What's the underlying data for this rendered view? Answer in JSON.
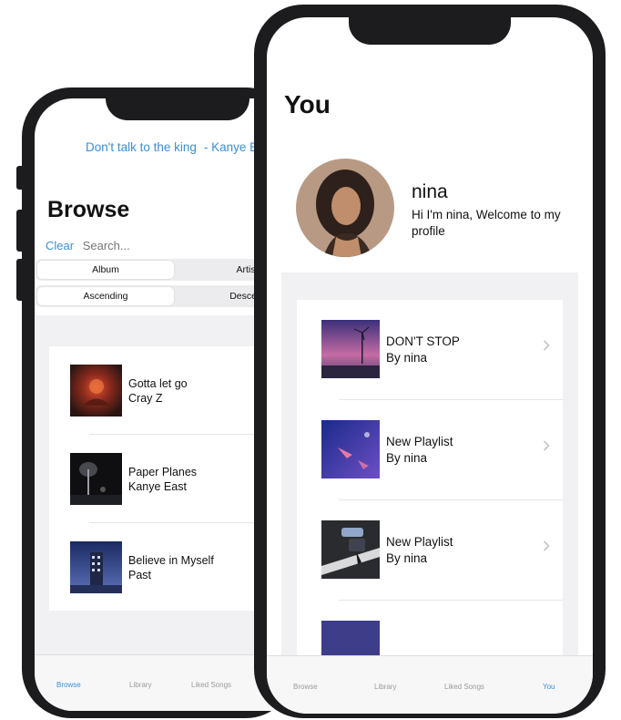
{
  "browse": {
    "now_playing": {
      "song": "Don't talk to the king",
      "artist": "- Kanye Ea"
    },
    "title": "Browse",
    "search": {
      "clear_label": "Clear",
      "placeholder": "Search..."
    },
    "filter_segment": {
      "options": [
        "Album",
        "Artis"
      ],
      "selected": "Album"
    },
    "sort_segment": {
      "options": [
        "Ascending",
        "Descen"
      ],
      "selected": "Ascending"
    },
    "songs": [
      {
        "title": "Gotta let go",
        "artist": "Cray Z"
      },
      {
        "title": "Paper Planes",
        "artist": "Kanye East"
      },
      {
        "title": "Believe in Myself",
        "artist": "Past"
      }
    ],
    "tabs": [
      {
        "label": "Browse",
        "active": true
      },
      {
        "label": "Library",
        "active": false
      },
      {
        "label": "Liked Songs",
        "active": false
      }
    ]
  },
  "you": {
    "title": "You",
    "profile": {
      "name": "nina",
      "bio": "Hi I'm nina, Welcome to my profile"
    },
    "playlists": [
      {
        "title": "DON'T STOP",
        "by": "By nina",
        "icon": "chevron-right-icon"
      },
      {
        "title": "New Playlist",
        "by": "By nina",
        "icon": "chevron-right-icon"
      },
      {
        "title": "New Playlist",
        "by": "By nina",
        "icon": "chevron-right-icon"
      }
    ],
    "tabs": [
      {
        "label": "Browse",
        "active": false
      },
      {
        "label": "Library",
        "active": false
      },
      {
        "label": "Liked Songs",
        "active": false
      },
      {
        "label": "You",
        "active": true
      }
    ]
  },
  "colors": {
    "accent": "#3a8fd6",
    "frame": "#1c1c1e",
    "background_group": "#f1f1f3",
    "tab_inactive": "#9a9a9c"
  }
}
